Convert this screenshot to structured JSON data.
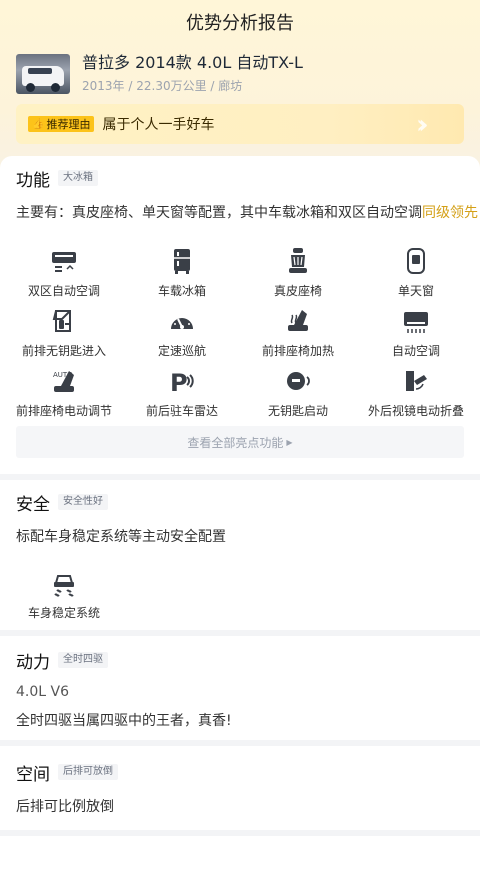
{
  "header": {
    "title": "优势分析报告"
  },
  "car": {
    "title": "普拉多 2014款 4.0L 自动TX-L",
    "year": "2013年",
    "mileage": "22.30万公里",
    "city": "廊坊"
  },
  "reason": {
    "tag": "推荐理由",
    "text": "属于个人一手好车"
  },
  "function": {
    "title": "功能",
    "badge": "大冰箱",
    "desc_main": "主要有：真皮座椅、单天窗等配置，其中车载冰箱和双区自动空调",
    "desc_highlight": "同级领先",
    "features": [
      {
        "label": "双区自动空调",
        "icon": "dual-zone-ac-icon"
      },
      {
        "label": "车载冰箱",
        "icon": "fridge-icon"
      },
      {
        "label": "真皮座椅",
        "icon": "leather-seat-icon"
      },
      {
        "label": "单天窗",
        "icon": "sunroof-icon"
      },
      {
        "label": "前排无钥匙进入",
        "icon": "keyless-entry-icon"
      },
      {
        "label": "定速巡航",
        "icon": "cruise-control-icon"
      },
      {
        "label": "前排座椅加热",
        "icon": "seat-heating-icon"
      },
      {
        "label": "自动空调",
        "icon": "auto-ac-icon"
      },
      {
        "label": "前排座椅电动调节",
        "icon": "power-seat-icon"
      },
      {
        "label": "前后驻车雷达",
        "icon": "parking-radar-icon"
      },
      {
        "label": "无钥匙启动",
        "icon": "keyless-start-icon"
      },
      {
        "label": "外后视镜电动折叠",
        "icon": "mirror-fold-icon"
      }
    ],
    "view_all": "查看全部亮点功能"
  },
  "safety": {
    "title": "安全",
    "badge": "安全性好",
    "desc": "标配车身稳定系统等主动安全配置",
    "feature": {
      "label": "车身稳定系统",
      "icon": "stability-control-icon"
    }
  },
  "power": {
    "title": "动力",
    "badge": "全时四驱",
    "engine": "4.0L V6",
    "desc": "全时四驱当属四驱中的王者，真香!"
  },
  "space": {
    "title": "空间",
    "badge": "后排可放倒",
    "desc": "后排可比例放倒"
  },
  "colors": {
    "accent": "#d4a017",
    "tag": "#fcc31a",
    "icon": "#3a3f47"
  }
}
